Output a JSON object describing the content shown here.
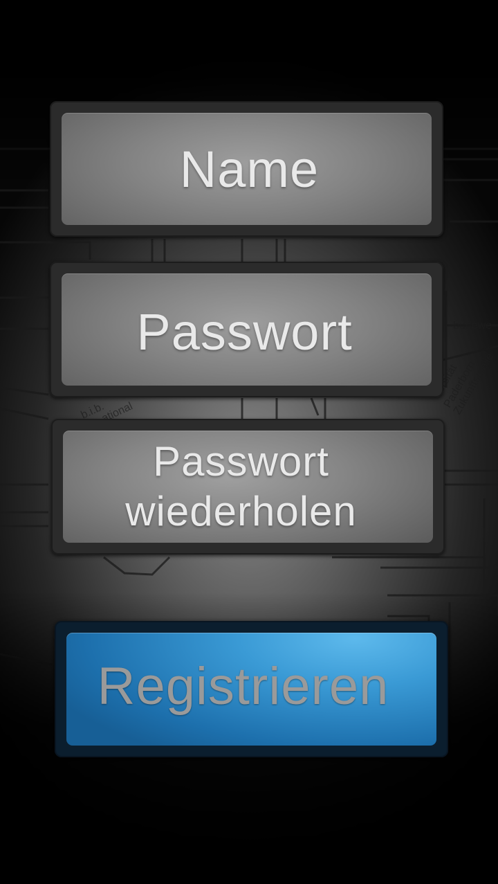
{
  "form": {
    "name_placeholder": "Name",
    "password_placeholder": "Passwort",
    "password_repeat_placeholder": "Passwort\nwiederholen",
    "submit_label": "Registrieren"
  },
  "colors": {
    "field_fill": "#8a8a8a",
    "field_text": "#e9e9e9",
    "frame": "#2b2b2b",
    "button_fill": "#3a9ad5",
    "button_text": "#9a9a9a"
  }
}
